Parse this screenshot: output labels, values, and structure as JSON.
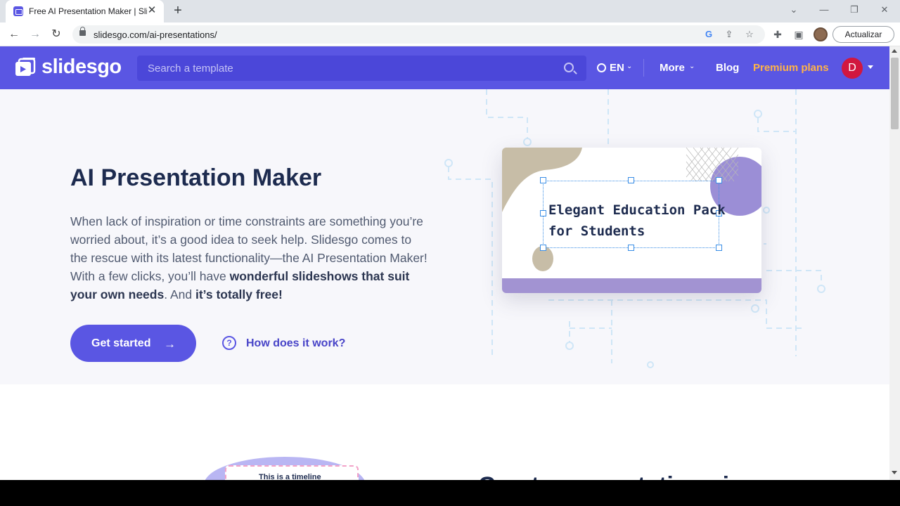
{
  "browser": {
    "tab_title": "Free AI Presentation Maker | Slid",
    "tab_close": "✕",
    "new_tab": "+",
    "url": "slidesgo.com/ai-presentations/",
    "update_button": "Actualizar"
  },
  "site": {
    "logo_text": "slidesgo",
    "search_placeholder": "Search a template",
    "language": "EN",
    "more": "More",
    "blog": "Blog",
    "premium": "Premium plans",
    "avatar_letter": "D",
    "brand_color": "#5a56e3",
    "premium_color": "#ffb347"
  },
  "hero": {
    "title": "AI Presentation Maker",
    "desc_part1": "When lack of inspiration or time constraints are something you’re worried about, it’s a good idea to seek help. Slidesgo comes to the rescue with its latest functionality—the AI Presentation Maker! With a few clicks, you’ll have ",
    "desc_bold1": "wonderful slideshows that suit your own needs",
    "desc_part2": ". And ",
    "desc_bold2": "it’s totally free!",
    "cta": "Get started",
    "cta_icon": "→",
    "help_link": "How does it work?",
    "help_icon": "?"
  },
  "preview": {
    "slide_title_line1": "Elegant Education Pack",
    "slide_title_line2": "for Students"
  },
  "below": {
    "timeline_card": "This is a timeline",
    "section_heading": "Create presentations in minutes"
  }
}
